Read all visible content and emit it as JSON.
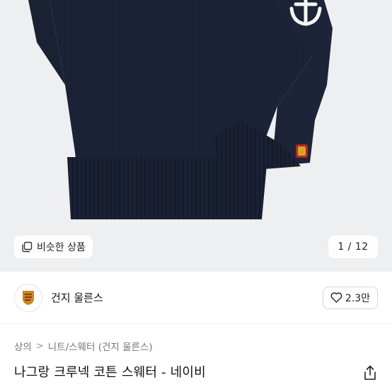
{
  "image": {
    "similar_label": "비슷한 상품",
    "page_counter": "1 / 12",
    "background_color": "#eeeff0",
    "sweater_color": "#1b2236"
  },
  "brand": {
    "name": "건지 울른스",
    "like_count": "2.3만",
    "logo_icon": "lion-crest-icon",
    "logo_color": "#c8861c"
  },
  "breadcrumb": {
    "items": [
      "상의",
      "니트/스웨터 (건지 울른스)"
    ],
    "separator": ">"
  },
  "product": {
    "title": "나그랑 크루넥 코튼 스웨터 - 네이비"
  },
  "icons": {
    "similar": "copy-squares-icon",
    "like": "heart-outline-icon",
    "share": "share-icon"
  }
}
